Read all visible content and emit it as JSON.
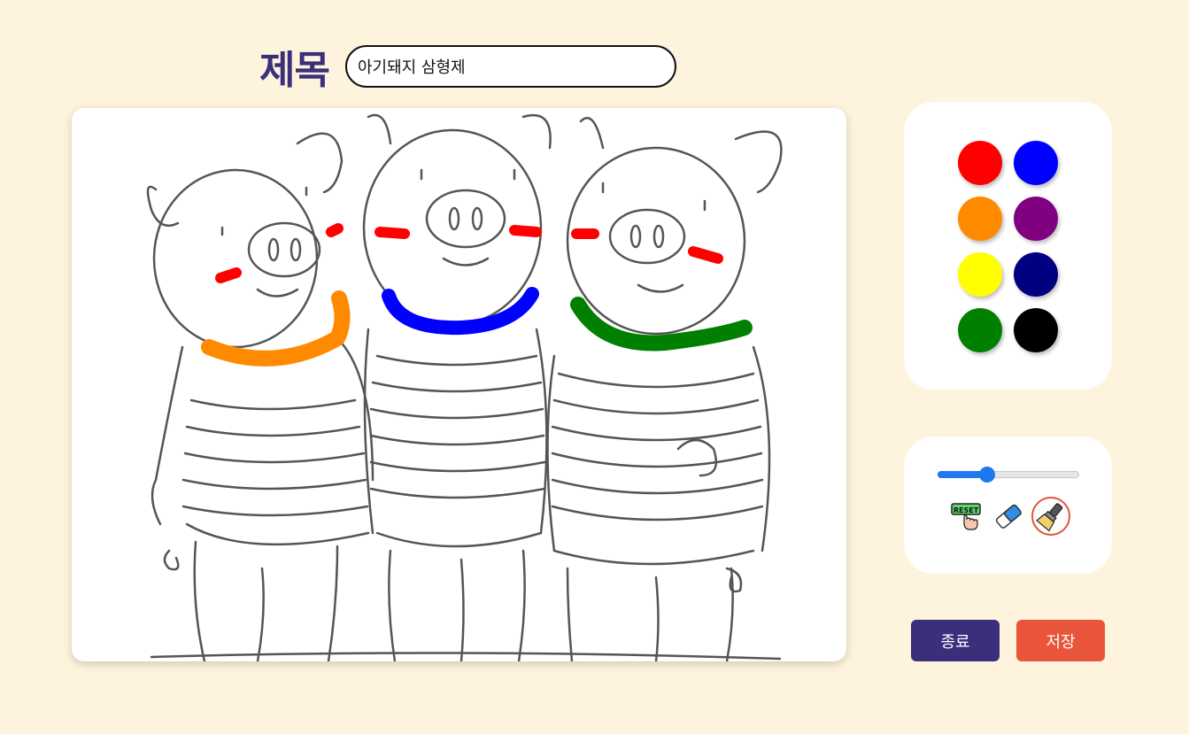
{
  "header": {
    "title_label": "제목",
    "title_value": "아기돼지 삼형제"
  },
  "canvas": {
    "image": "three-little-pigs-coloring-sketch",
    "strokes": [
      {
        "color": "#ff0000",
        "part": "cheeks"
      },
      {
        "color": "#ff8a00",
        "part": "scarf-left-pig"
      },
      {
        "color": "#0000ff",
        "part": "scarf-middle-pig"
      },
      {
        "color": "#008000",
        "part": "scarf-right-pig"
      }
    ]
  },
  "palette": {
    "colors": [
      "#ff0000",
      "#0000ff",
      "#ff8a00",
      "#800080",
      "#ffff00",
      "#000080",
      "#008000",
      "#000000"
    ]
  },
  "tools": {
    "brush_size_fraction": 0.35,
    "reset_icon_text": "RESET",
    "items": [
      "reset-icon",
      "eraser-icon",
      "brush-icon"
    ],
    "selected": "brush-icon"
  },
  "actions": {
    "exit_label": "종료",
    "save_label": "저장"
  },
  "colors": {
    "background": "#fef3dd",
    "title": "#3a2f7a",
    "exit_button": "#3a2f7a",
    "save_button": "#e8553b",
    "slider": "#1e78f0"
  }
}
